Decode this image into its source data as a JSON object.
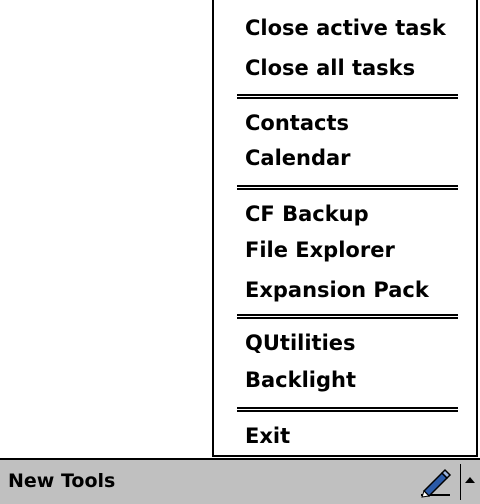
{
  "menu": {
    "items": [
      {
        "label": "Close active task"
      },
      {
        "label": "Close all tasks"
      },
      {
        "label": "Contacts"
      },
      {
        "label": "Calendar"
      },
      {
        "label": "CF Backup"
      },
      {
        "label": "File Explorer"
      },
      {
        "label": "Expansion Pack"
      },
      {
        "label": "QUtilities"
      },
      {
        "label": "Backlight"
      },
      {
        "label": "Exit"
      }
    ]
  },
  "taskbar": {
    "title": "New Tools",
    "input_icon": "pen-icon",
    "toggle_icon": "up-arrow-icon"
  },
  "colors": {
    "menu_background": "#ffffff",
    "text": "#000000",
    "taskbar_background": "#c0c0c0",
    "pen_accent": "#2a5aa8"
  }
}
